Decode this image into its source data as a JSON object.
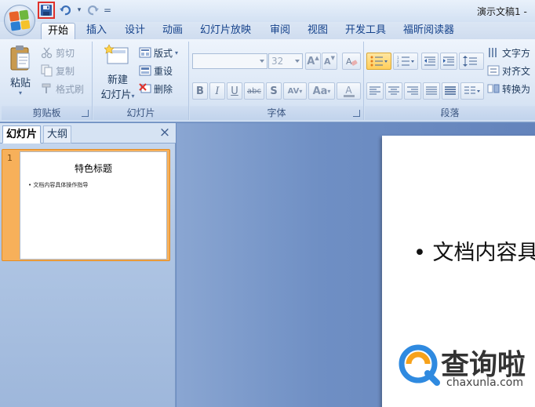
{
  "window": {
    "title": "演示文稿1 -"
  },
  "qat": {
    "separator": "="
  },
  "tabs": [
    {
      "label": "开始",
      "active": true
    },
    {
      "label": "插入"
    },
    {
      "label": "设计"
    },
    {
      "label": "动画"
    },
    {
      "label": "幻灯片放映"
    },
    {
      "label": "审阅"
    },
    {
      "label": "视图"
    },
    {
      "label": "开发工具"
    },
    {
      "label": "福昕阅读器"
    }
  ],
  "ribbon": {
    "clipboard": {
      "label": "剪贴板",
      "paste": "粘贴",
      "cut": "剪切",
      "copy": "复制",
      "format_painter": "格式刷"
    },
    "slides": {
      "label": "幻灯片",
      "new_slide_line1": "新建",
      "new_slide_line2": "幻灯片",
      "layout": "版式",
      "reset": "重设",
      "delete": "删除"
    },
    "font": {
      "label": "字体",
      "font_name": "",
      "font_size": "32",
      "bold": "B",
      "italic": "I",
      "underline": "U",
      "strike": "abc",
      "shadow": "S",
      "spacing": "AV",
      "case": "Aa",
      "color": "A",
      "grow": "A",
      "shrink": "A"
    },
    "paragraph": {
      "label": "段落",
      "text_direction": "文字方",
      "align_text": "对齐文",
      "convert": "转换为"
    }
  },
  "left_panel": {
    "tabs": [
      {
        "label": "幻灯片",
        "active": true
      },
      {
        "label": "大纲"
      }
    ],
    "close": "×",
    "slides": [
      {
        "number": "1",
        "title": "特色标题",
        "bullet": "• 文档内容具体操作指导"
      }
    ]
  },
  "slide": {
    "bullet": "• 文档内容具"
  },
  "watermark": {
    "text": "查询啦",
    "url": "chaxunla.com"
  },
  "colors": {
    "accent": "#15428b",
    "selection": "#f7b05a",
    "highlight": "#e0312b"
  }
}
